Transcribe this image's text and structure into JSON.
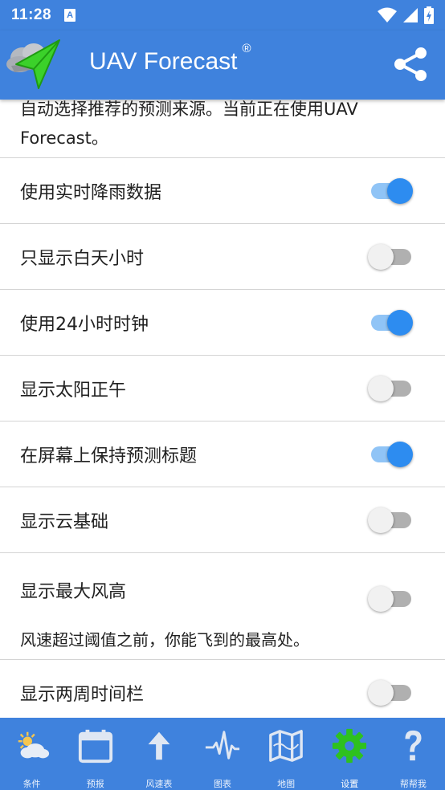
{
  "status": {
    "time": "11:28",
    "a_badge": "A"
  },
  "app": {
    "title": "UAV Forecast",
    "registered": "®"
  },
  "content": {
    "top_description": "自动选择推荐的预测来源。当前正在使用UAV Forecast。",
    "settings": [
      {
        "label": "使用实时降雨数据",
        "on": true
      },
      {
        "label": "只显示白天小时",
        "on": false
      },
      {
        "label": "使用24小时时钟",
        "on": true
      },
      {
        "label": "显示太阳正午",
        "on": false
      },
      {
        "label": "在屏幕上保持预测标题",
        "on": true
      },
      {
        "label": "显示云基础",
        "on": false
      },
      {
        "label": "显示最大风高",
        "on": false,
        "description": "风速超过阈值之前，你能飞到的最高处。"
      },
      {
        "label": "显示两周时间栏",
        "on": false
      }
    ]
  },
  "bottom_nav": [
    {
      "label": "条件",
      "icon": "weather-icon"
    },
    {
      "label": "预报",
      "icon": "calendar-icon"
    },
    {
      "label": "风速表",
      "icon": "arrow-up-icon"
    },
    {
      "label": "图表",
      "icon": "pulse-icon"
    },
    {
      "label": "地图",
      "icon": "map-icon"
    },
    {
      "label": "设置",
      "icon": "gear-icon",
      "active": true
    },
    {
      "label": "帮帮我",
      "icon": "help-icon"
    }
  ],
  "colors": {
    "primary": "#3f82dd",
    "toggle_on": "#2d8cf0",
    "toggle_on_track": "#90c4f6",
    "active_icon": "#2ec11f"
  }
}
